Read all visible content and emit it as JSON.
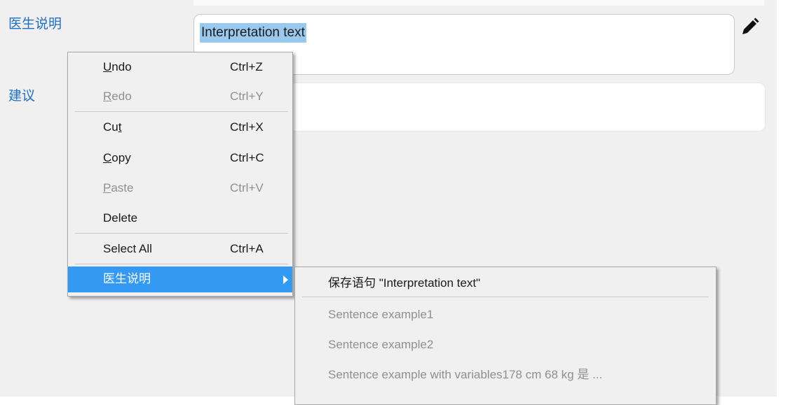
{
  "form": {
    "interpretation_label": "医生说明",
    "advice_label": "建议",
    "interpretation_value": "Interpretation text",
    "advice_value": "",
    "edit_icon": "pencil-icon"
  },
  "context_menu": {
    "undo": {
      "pre": "",
      "u": "U",
      "post": "ndo",
      "shortcut": "Ctrl+Z",
      "enabled": true
    },
    "redo": {
      "pre": "",
      "u": "R",
      "post": "edo",
      "shortcut": "Ctrl+Y",
      "enabled": false
    },
    "cut": {
      "pre": "Cu",
      "u": "t",
      "post": "",
      "shortcut": "Ctrl+X",
      "enabled": true
    },
    "copy": {
      "pre": "",
      "u": "C",
      "post": "opy",
      "shortcut": "Ctrl+C",
      "enabled": true
    },
    "paste": {
      "pre": "",
      "u": "P",
      "post": "aste",
      "shortcut": "Ctrl+V",
      "enabled": false
    },
    "delete": {
      "label": "Delete",
      "enabled": true
    },
    "select_all": {
      "label": "Select All",
      "shortcut": "Ctrl+A",
      "enabled": true
    },
    "submenu_label": "医生说明"
  },
  "submenu": {
    "save_sentence": "保存语句 \"Interpretation text\"",
    "items": [
      "Sentence example1",
      "Sentence example2",
      "Sentence example with variables178 cm 68 kg 是 ..."
    ]
  },
  "colors": {
    "label_blue": "#1f6fc2",
    "selection": "#99c9ef",
    "menu_highlight": "#3399f3",
    "disabled_text": "#8f8f8f"
  }
}
